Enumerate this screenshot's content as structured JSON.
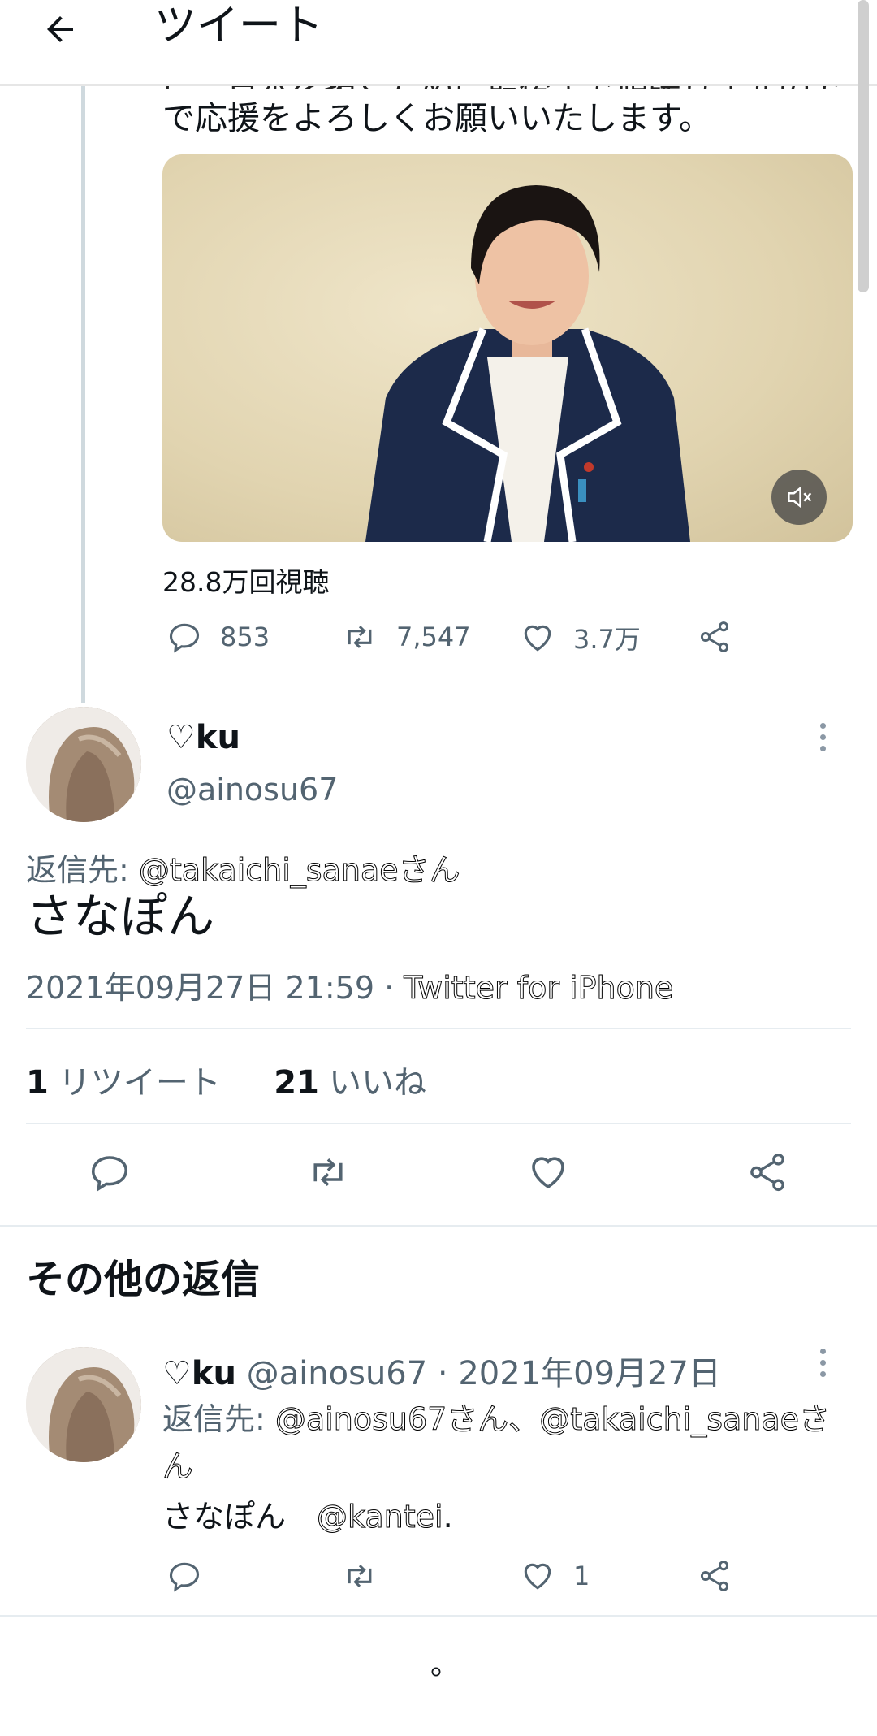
{
  "header": {
    "title": "ツイート",
    "back_icon": "arrow-left-icon"
  },
  "parent_tweet": {
    "cut_line": "に、日本を拓くために最後まで頑張りますので",
    "text_tail": "で応援をよろしくお願いいたします。",
    "video": {
      "mute_icon": "muted-speaker-icon"
    },
    "views": "28.8万回視聴",
    "actions": {
      "replies": "853",
      "retweets": "7,547",
      "likes": "3.7万"
    }
  },
  "reply_tweet": {
    "display_name": "♡ku",
    "handle": "@ainosu67",
    "reply_to_label": "返信先: ",
    "reply_to_mention": "@takaichi_sanaeさん",
    "text": "さなぽん",
    "timestamp": "2021年09月27日 21:59 · ",
    "source": "Twitter for iPhone",
    "retweet_count": "1",
    "retweet_label": "リツイート",
    "like_count": "21",
    "like_label": "いいね"
  },
  "more_replies": {
    "heading": "その他の返信",
    "items": [
      {
        "display_name": "♡ku",
        "handle_date": " @ainosu67 · 2021年09月27日",
        "reply_to_label": "返信先: ",
        "reply_to_mentions": "@ainosu67さん、@takaichi_sanaeさん",
        "text": "さなぽん　",
        "text_mention": "@kantei",
        "text_tail": ".",
        "like_count": "1"
      }
    ]
  },
  "footer": {
    "marker": "。"
  },
  "colors": {
    "text": "#0f1419",
    "muted": "#536471",
    "divider": "#e6ecf0"
  }
}
